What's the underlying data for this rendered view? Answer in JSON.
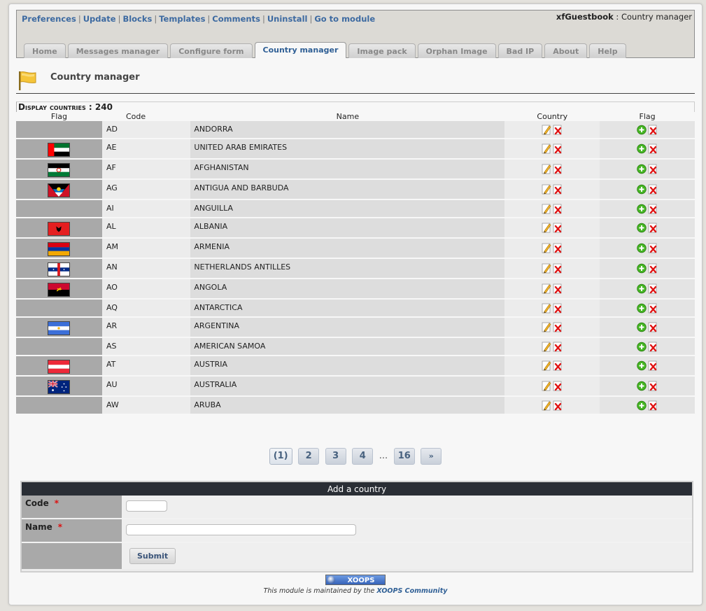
{
  "topmenu": [
    "Preferences",
    "Update",
    "Blocks",
    "Templates",
    "Comments",
    "Uninstall",
    "Go to module"
  ],
  "module": {
    "name": "xfGuestbook",
    "sep": " : ",
    "page": "Country manager"
  },
  "tabs": [
    "Home",
    "Messages manager",
    "Configure form",
    "Country manager",
    "Image pack",
    "Orphan Image",
    "Bad IP",
    "About",
    "Help"
  ],
  "active_tab": "Country manager",
  "page_title": "Country manager",
  "list": {
    "heading": "Display countries : 240",
    "columns": {
      "flag": "Flag",
      "code": "Code",
      "name": "Name",
      "country": "Country",
      "flag_actions": "Flag"
    },
    "rows": [
      {
        "code": "AD",
        "name": "ANDORRA",
        "flag": "none"
      },
      {
        "code": "AE",
        "name": "UNITED ARAB EMIRATES",
        "flag": "ae"
      },
      {
        "code": "AF",
        "name": "AFGHANISTAN",
        "flag": "af"
      },
      {
        "code": "AG",
        "name": "ANTIGUA AND BARBUDA",
        "flag": "ag"
      },
      {
        "code": "AI",
        "name": "ANGUILLA",
        "flag": "none"
      },
      {
        "code": "AL",
        "name": "ALBANIA",
        "flag": "al"
      },
      {
        "code": "AM",
        "name": "ARMENIA",
        "flag": "am"
      },
      {
        "code": "AN",
        "name": "NETHERLANDS ANTILLES",
        "flag": "an"
      },
      {
        "code": "AO",
        "name": "ANGOLA",
        "flag": "ao"
      },
      {
        "code": "AQ",
        "name": "ANTARCTICA",
        "flag": "none"
      },
      {
        "code": "AR",
        "name": "ARGENTINA",
        "flag": "ar"
      },
      {
        "code": "AS",
        "name": "AMERICAN SAMOA",
        "flag": "none"
      },
      {
        "code": "AT",
        "name": "AUSTRIA",
        "flag": "at"
      },
      {
        "code": "AU",
        "name": "AUSTRALIA",
        "flag": "au"
      },
      {
        "code": "AW",
        "name": "ARUBA",
        "flag": "none"
      }
    ]
  },
  "pagination": {
    "current": "(1)",
    "pages": [
      "2",
      "3",
      "4"
    ],
    "dots": "...",
    "last": "16",
    "next": "»"
  },
  "form": {
    "title": "Add a country",
    "code_label": "Code",
    "name_label": "Name",
    "required": "*",
    "code_value": "",
    "name_value": "",
    "submit_label": "Submit"
  },
  "footer": {
    "badge": "XOOPS",
    "text_before": "This module is maintained by the ",
    "link": "XOOPS Community"
  },
  "colors": {
    "link": "#3d6aa1",
    "active_tab": "#2f5f95",
    "form_header": "#2a2e35",
    "required": "#dd1111"
  },
  "icons": {
    "edit": "pencil-edit-icon",
    "delete": "red-x-delete-icon",
    "add": "green-plus-add-icon",
    "page": "yellow-flag-icon"
  }
}
